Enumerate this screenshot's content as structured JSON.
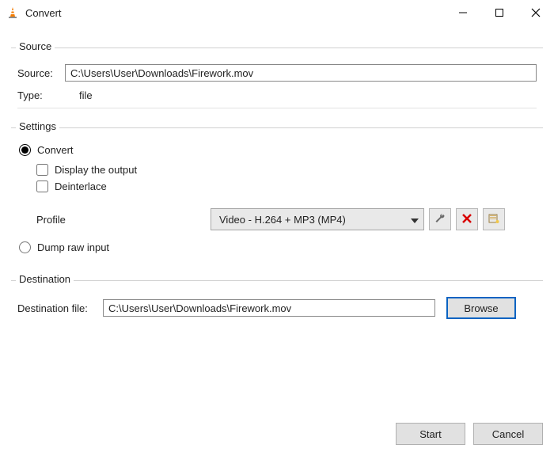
{
  "window": {
    "title": "Convert"
  },
  "source_group": {
    "legend": "Source",
    "source_label": "Source:",
    "source_value": "C:\\Users\\User\\Downloads\\Firework.mov",
    "type_label": "Type:",
    "type_value": "file"
  },
  "settings_group": {
    "legend": "Settings",
    "convert_label": "Convert",
    "display_output_label": "Display the output",
    "deinterlace_label": "Deinterlace",
    "profile_label": "Profile",
    "profile_selected": "Video - H.264 + MP3 (MP4)",
    "dump_raw_label": "Dump raw input"
  },
  "destination_group": {
    "legend": "Destination",
    "dest_label": "Destination file:",
    "dest_value": "C:\\Users\\User\\Downloads\\Firework.mov",
    "browse_label": "Browse"
  },
  "footer": {
    "start_label": "Start",
    "cancel_label": "Cancel"
  }
}
